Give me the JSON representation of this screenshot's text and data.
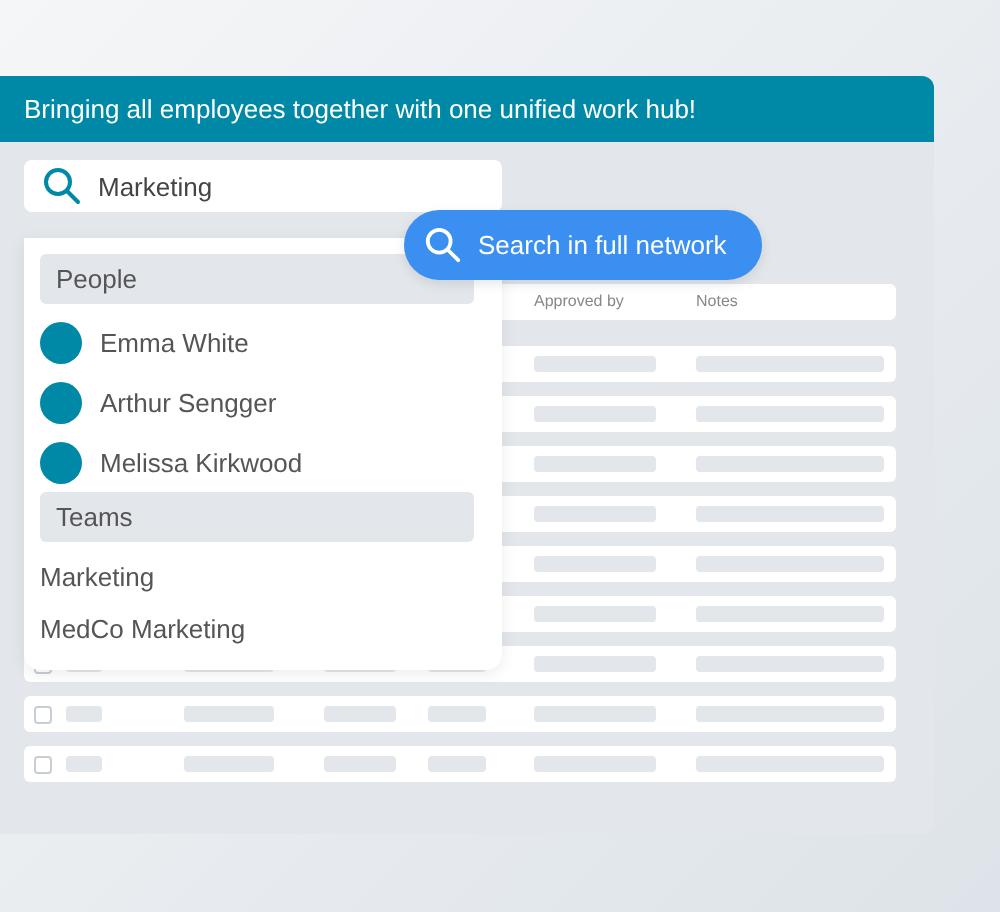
{
  "banner": {
    "title": "Bringing all employees together with one unified work hub!"
  },
  "search": {
    "value": "Marketing"
  },
  "network_button": {
    "label": "Search in full network"
  },
  "table": {
    "columns": [
      {
        "label": "Approved by"
      },
      {
        "label": "Notes"
      }
    ],
    "rows": [
      {
        "checked": false
      },
      {
        "checked": false
      },
      {
        "checked": false
      }
    ]
  },
  "dropdown": {
    "sections": [
      {
        "heading": "People",
        "kind": "people",
        "items": [
          {
            "label": "Emma White"
          },
          {
            "label": "Arthur Sengger"
          },
          {
            "label": "Melissa Kirkwood"
          }
        ]
      },
      {
        "heading": "Teams",
        "kind": "teams",
        "items": [
          {
            "label": "Marketing"
          },
          {
            "label": "MedCo Marketing"
          }
        ]
      }
    ]
  }
}
